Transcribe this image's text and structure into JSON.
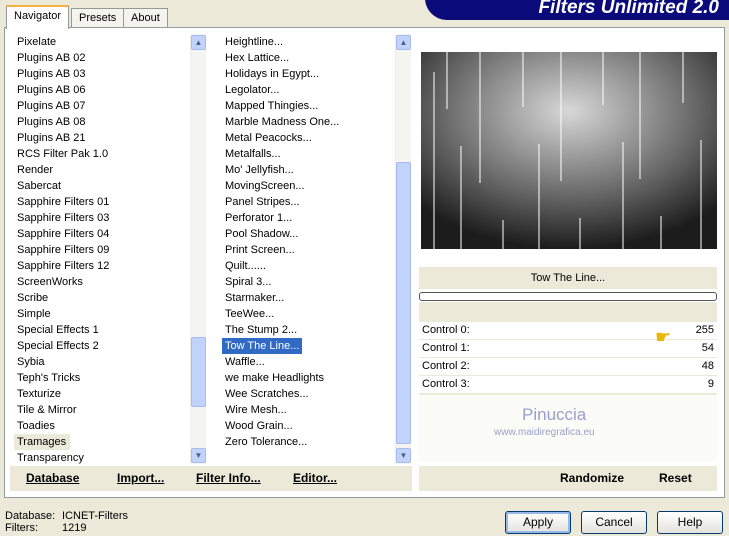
{
  "app_title": "Filters Unlimited 2.0",
  "tabs": [
    {
      "label": "Navigator"
    },
    {
      "label": "Presets"
    },
    {
      "label": "About"
    }
  ],
  "categories": [
    "Pixelate",
    "Plugins AB 02",
    "Plugins AB 03",
    "Plugins AB 06",
    "Plugins AB 07",
    "Plugins AB 08",
    "Plugins AB 21",
    "RCS Filter Pak 1.0",
    "Render",
    "Sabercat",
    "Sapphire Filters 01",
    "Sapphire Filters 03",
    "Sapphire Filters 04",
    "Sapphire Filters 09",
    "Sapphire Filters 12",
    "ScreenWorks",
    "Scribe",
    "Simple",
    "Special Effects 1",
    "Special Effects 2",
    "Sybia",
    "Teph's Tricks",
    "Texturize",
    "Tile & Mirror",
    "Toadies",
    "Tramages",
    "Transparency"
  ],
  "selected_category": "Tramages",
  "filters": [
    "Heightline...",
    "Hex Lattice...",
    "Holidays in Egypt...",
    "Legolator...",
    "Mapped Thingies...",
    "Marble Madness One...",
    "Metal Peacocks...",
    "Metalfalls...",
    "Mo' Jellyfish...",
    "MovingScreen...",
    "Panel Stripes...",
    "Perforator 1...",
    "Pool Shadow...",
    "Print Screen...",
    "Quilt......",
    "Spiral 3...",
    "Starmaker...",
    "TeeWee...",
    "The Stump 2...",
    "Tow The Line...",
    "Waffle...",
    "we make Headlights",
    "Wee Scratches...",
    "Wire Mesh...",
    "Wood Grain...",
    "Zero Tolerance..."
  ],
  "selected_filter": "Tow The Line...",
  "filter_name": "Tow The Line...",
  "controls": [
    {
      "label": "Control 0:",
      "value": "255"
    },
    {
      "label": "Control 1:",
      "value": "54"
    },
    {
      "label": "Control 2:",
      "value": "48"
    },
    {
      "label": "Control 3:",
      "value": "9"
    }
  ],
  "watermark": {
    "name": "Pinuccia",
    "url": "www.maidiregrafica.eu"
  },
  "toolbar": {
    "database": "Database",
    "import": "Import...",
    "filter_info": "Filter Info...",
    "editor": "Editor...",
    "randomize": "Randomize",
    "reset": "Reset"
  },
  "status": {
    "database_label": "Database:",
    "database_value": "ICNET-Filters",
    "filters_label": "Filters:",
    "filters_value": "1219"
  },
  "buttons": {
    "apply": "Apply",
    "cancel": "Cancel",
    "help": "Help"
  }
}
